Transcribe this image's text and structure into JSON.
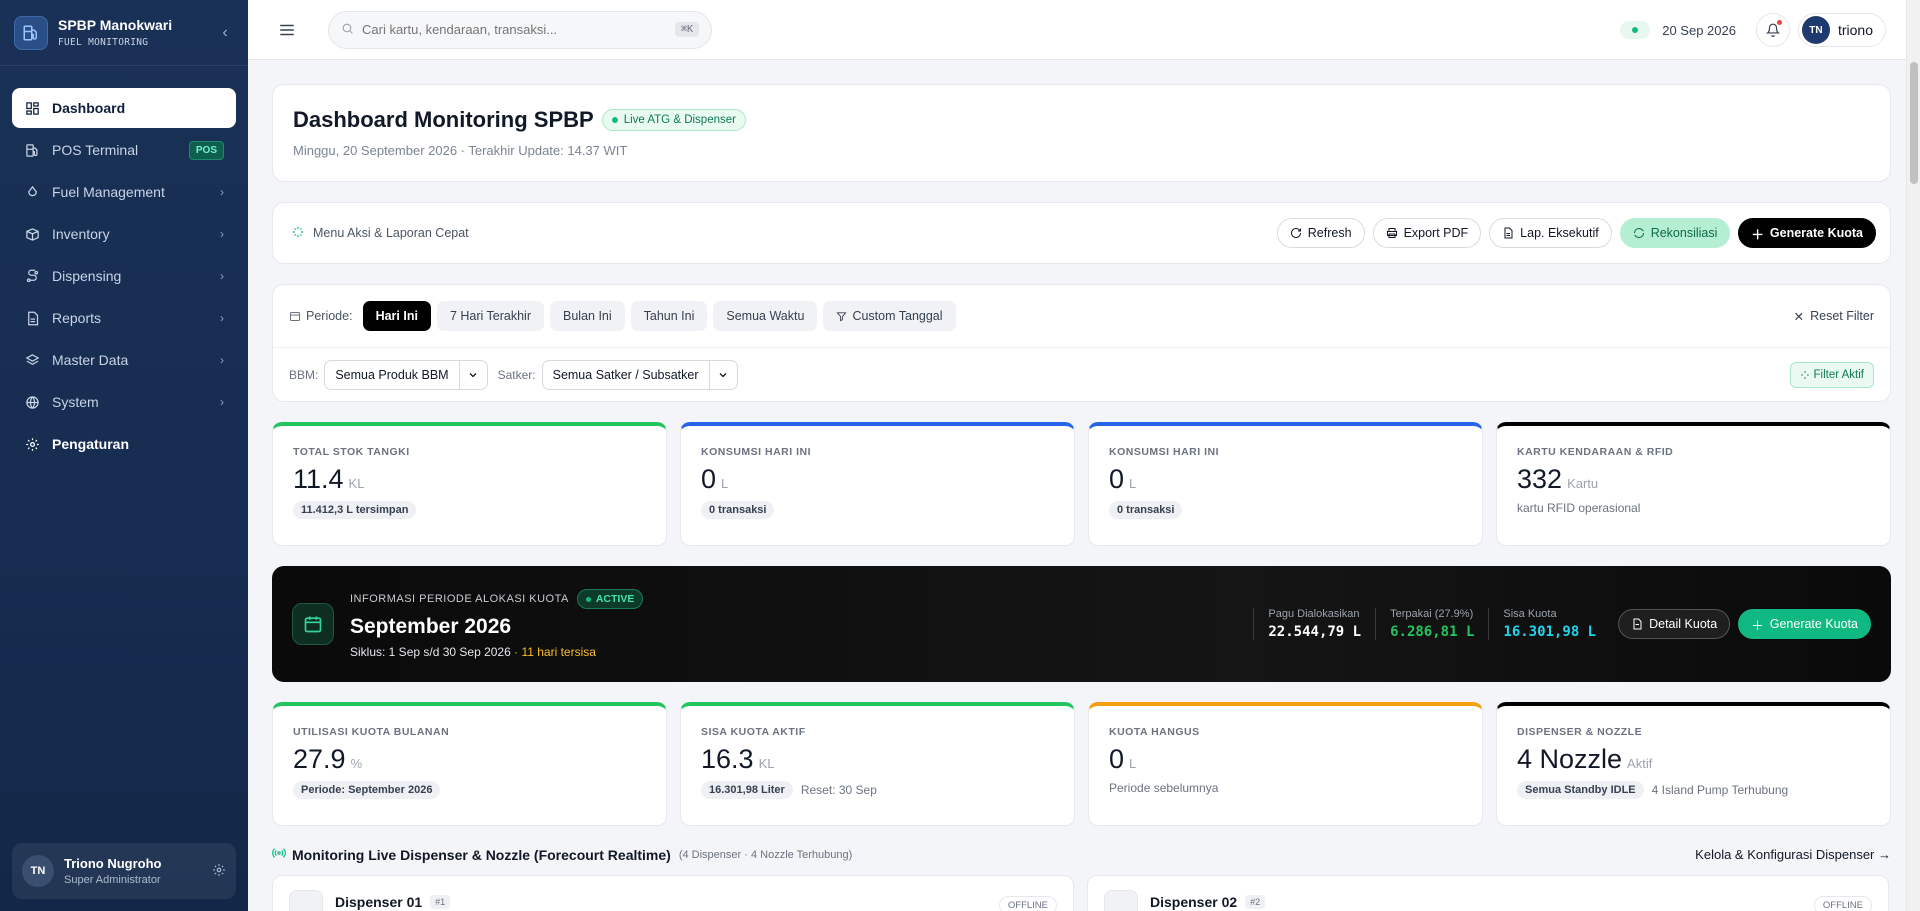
{
  "brand": {
    "name": "SPBP Manokwari",
    "subtitle": "FUEL MONITORING"
  },
  "sidebar": {
    "items": [
      {
        "label": "Dashboard",
        "icon": "dashboard-icon",
        "active": true
      },
      {
        "label": "POS Terminal",
        "icon": "fuel-pump-icon",
        "badge": "POS"
      },
      {
        "label": "Fuel Management",
        "icon": "droplet-icon",
        "chevron": true
      },
      {
        "label": "Inventory",
        "icon": "box-icon",
        "chevron": true
      },
      {
        "label": "Dispensing",
        "icon": "route-icon",
        "chevron": true
      },
      {
        "label": "Reports",
        "icon": "report-icon",
        "chevron": true
      },
      {
        "label": "Master Data",
        "icon": "layers-icon",
        "chevron": true
      },
      {
        "label": "System",
        "icon": "globe-icon",
        "chevron": true
      },
      {
        "label": "Pengaturan",
        "icon": "gear-icon"
      }
    ],
    "user": {
      "initials": "TN",
      "name": "Triono Nugroho",
      "role": "Super Administrator"
    }
  },
  "topbar": {
    "search_placeholder": "Cari kartu, kendaraan, transaksi...",
    "shortcut": "⌘K",
    "date": "20 Sep 2026",
    "user_initials": "TN",
    "user_name": "triono"
  },
  "header": {
    "title": "Dashboard Monitoring SPBP",
    "live_badge": "Live ATG & Dispenser",
    "subtitle": "Minggu, 20 September 2026 · Terakhir Update: 14.37 WIT"
  },
  "actions": {
    "label": "Menu Aksi & Laporan Cepat",
    "refresh": "Refresh",
    "export_pdf": "Export PDF",
    "lap_eksekutif": "Lap. Eksekutif",
    "rekonsiliasi": "Rekonsiliasi",
    "generate_kuota": "Generate Kuota"
  },
  "filters": {
    "periode_label": "Periode:",
    "periods": [
      "Hari Ini",
      "7 Hari Terakhir",
      "Bulan Ini",
      "Tahun Ini",
      "Semua Waktu"
    ],
    "custom": "Custom Tanggal",
    "reset": "Reset Filter",
    "bbm_label": "BBM:",
    "bbm_value": "Semua Produk BBM",
    "satker_label": "Satker:",
    "satker_value": "Semua Satker / Subsatker",
    "filter_aktif": "Filter Aktif"
  },
  "stats1": [
    {
      "label": "TOTAL STOK TANGKI",
      "value": "11.4",
      "unit": "KL",
      "pill": "11.412,3 L tersimpan"
    },
    {
      "label": "KONSUMSI HARI INI",
      "value": "0",
      "unit": "L",
      "pill": "0 transaksi"
    },
    {
      "label": "KONSUMSI HARI INI",
      "value": "0",
      "unit": "L",
      "pill": "0 transaksi"
    },
    {
      "label": "KARTU KENDARAAN & RFID",
      "value": "332",
      "unit": "Kartu",
      "note": "kartu RFID operasional"
    }
  ],
  "quota": {
    "caption": "INFORMASI PERIODE ALOKASI KUOTA",
    "status": "ACTIVE",
    "title": "September 2026",
    "cycle": "Siklus: 1 Sep s/d 30 Sep 2026",
    "remaining": "· 11 hari tersisa",
    "pagu_label": "Pagu Dialokasikan",
    "pagu_value": "22.544,79 L",
    "terpakai_label": "Terpakai (27.9%)",
    "terpakai_value": "6.286,81 L",
    "sisa_label": "Sisa Kuota",
    "sisa_value": "16.301,98 L",
    "detail_btn": "Detail Kuota",
    "generate_btn": "Generate Kuota"
  },
  "stats2": [
    {
      "label": "UTILISASI KUOTA BULANAN",
      "value": "27.9",
      "unit": "%",
      "pill": "Periode: September 2026"
    },
    {
      "label": "SISA KUOTA AKTIF",
      "value": "16.3",
      "unit": "KL",
      "pill": "16.301,98 Liter",
      "note": "Reset: 30 Sep"
    },
    {
      "label": "KUOTA HANGUS",
      "value": "0",
      "unit": "L",
      "note": "Periode sebelumnya"
    },
    {
      "label": "DISPENSER & NOZZLE",
      "value": "4 Nozzle",
      "unit": "Aktif",
      "pill": "Semua Standby IDLE",
      "note": "4 Island Pump Terhubung"
    }
  ],
  "monitoring": {
    "title": "Monitoring Live Dispenser & Nozzle (Forecourt Realtime)",
    "subtitle": "(4 Dispenser · 4 Nozzle Terhubung)",
    "link": "Kelola & Konfigurasi Dispenser →",
    "dispensers": [
      {
        "name": "Dispenser 01",
        "num": "#1",
        "status": "OFFLINE"
      },
      {
        "name": "Dispenser 02",
        "num": "#2",
        "status": "OFFLINE"
      }
    ]
  },
  "colors": {
    "sidebar_bg": "#1a3157",
    "accent_green": "#10b981",
    "quota_cyan": "#22d3ee"
  }
}
